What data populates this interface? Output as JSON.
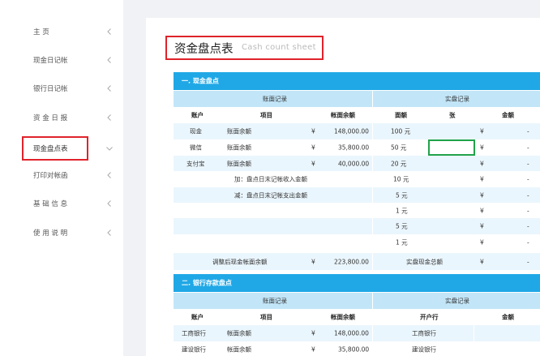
{
  "sidebar": {
    "items": [
      {
        "label": "主        页"
      },
      {
        "label": "现金日记帐"
      },
      {
        "label": "银行日记帐"
      },
      {
        "label": "资 金 日 报"
      },
      {
        "label": "现金盘点表"
      },
      {
        "label": "打印对帐函"
      },
      {
        "label": "基 础 信 息"
      },
      {
        "label": "使 用 说 明"
      }
    ],
    "active_index": 4
  },
  "page": {
    "title": "资金盘点表",
    "subtitle": "Cash count sheet"
  },
  "cash_section": {
    "title": "一. 现金盘点",
    "book_header": "账面记录",
    "actual_header": "实盘记录",
    "columns": {
      "account": "账户",
      "item": "项目",
      "balance": "帐面余额",
      "denomination": "面额",
      "count": "张",
      "amount": "金额"
    },
    "rows": [
      {
        "account": "现金",
        "item": "账面余额",
        "currency": "¥",
        "balance": "148,000.00",
        "denom": "100 元",
        "cur2": "¥",
        "amt": "-"
      },
      {
        "account": "微信",
        "item": "账面余额",
        "currency": "¥",
        "balance": "35,800.00",
        "denom": "50 元",
        "cur2": "¥",
        "amt": "-"
      },
      {
        "account": "支付宝",
        "item": "账面余额",
        "currency": "¥",
        "balance": "40,000.00",
        "denom": "20 元",
        "cur2": "¥",
        "amt": "-"
      },
      {
        "account": "",
        "item": "加：盘点日末记帐收入金额",
        "currency": "",
        "balance": "",
        "denom": "10 元",
        "cur2": "¥",
        "amt": "-"
      },
      {
        "account": "",
        "item": "减：盘点日末记帐支出金额",
        "currency": "",
        "balance": "",
        "denom": "5 元",
        "cur2": "¥",
        "amt": "-"
      },
      {
        "account": "",
        "item": "",
        "currency": "",
        "balance": "",
        "denom": "1 元",
        "cur2": "¥",
        "amt": "-"
      },
      {
        "account": "",
        "item": "",
        "currency": "",
        "balance": "",
        "denom": "5 元",
        "cur2": "¥",
        "amt": "-"
      },
      {
        "account": "",
        "item": "",
        "currency": "",
        "balance": "",
        "denom": "1 元",
        "cur2": "¥",
        "amt": "-"
      }
    ],
    "adjusted_label": "调整后现金帐面余额",
    "adjusted_currency": "¥",
    "adjusted_value": "223,800.00",
    "actual_total_label": "实盘现金总额",
    "actual_total_currency": "¥",
    "actual_total_value": "-"
  },
  "bank_section": {
    "title": "二. 银行存款盘点",
    "book_header": "账面记录",
    "actual_header": "实盘记录",
    "columns": {
      "account": "账户",
      "item": "项目",
      "balance": "帐面余额",
      "bank": "开户行",
      "amount": "金额"
    },
    "rows": [
      {
        "account": "工商银行",
        "item": "帐面余额",
        "currency": "¥",
        "balance": "148,000.00",
        "bank": "工商银行"
      },
      {
        "account": "建设银行",
        "item": "帐面余额",
        "currency": "¥",
        "balance": "35,800.00",
        "bank": "建设银行"
      }
    ]
  }
}
